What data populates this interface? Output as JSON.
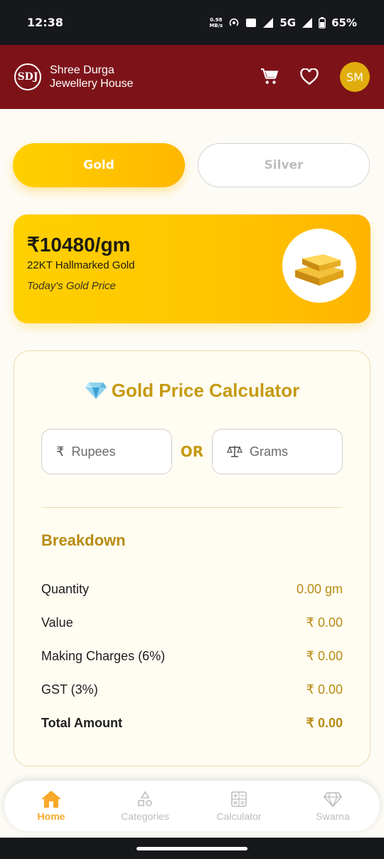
{
  "status": {
    "time": "12:38",
    "speed_top": "0.98",
    "speed_bottom": "MB/s",
    "network": "5G",
    "battery": "65%"
  },
  "header": {
    "logo_text": "SDJ",
    "brand_line1": "Shree Durga",
    "brand_line2": "Jewellery House",
    "avatar": "SM"
  },
  "toggle": {
    "gold": "Gold",
    "silver": "Silver"
  },
  "price_card": {
    "price": "₹10480/gm",
    "purity": "22KT Hallmarked Gold",
    "note": "Today's Gold Price"
  },
  "calculator": {
    "title": "Gold Price Calculator",
    "rupees_placeholder": "Rupees",
    "or_label": "OR",
    "grams_placeholder": "Grams",
    "breakdown_title": "Breakdown",
    "rows": [
      {
        "label": "Quantity",
        "value": "0.00 gm"
      },
      {
        "label": "Value",
        "value": "₹ 0.00"
      },
      {
        "label": "Making Charges (6%)",
        "value": "₹ 0.00"
      },
      {
        "label": "GST (3%)",
        "value": "₹ 0.00"
      },
      {
        "label": "Total Amount",
        "value": "₹ 0.00"
      }
    ]
  },
  "bottom_nav": {
    "items": [
      {
        "label": "Home",
        "icon": "home-icon"
      },
      {
        "label": "Categories",
        "icon": "shapes-icon"
      },
      {
        "label": "Calculator",
        "icon": "calculator-icon"
      },
      {
        "label": "Swarna",
        "icon": "diamond-icon"
      }
    ]
  },
  "colors": {
    "header_bg": "#7d1319",
    "gold": "#ffc400",
    "accent_text": "#c59a10",
    "nav_active": "#f7a92a"
  }
}
